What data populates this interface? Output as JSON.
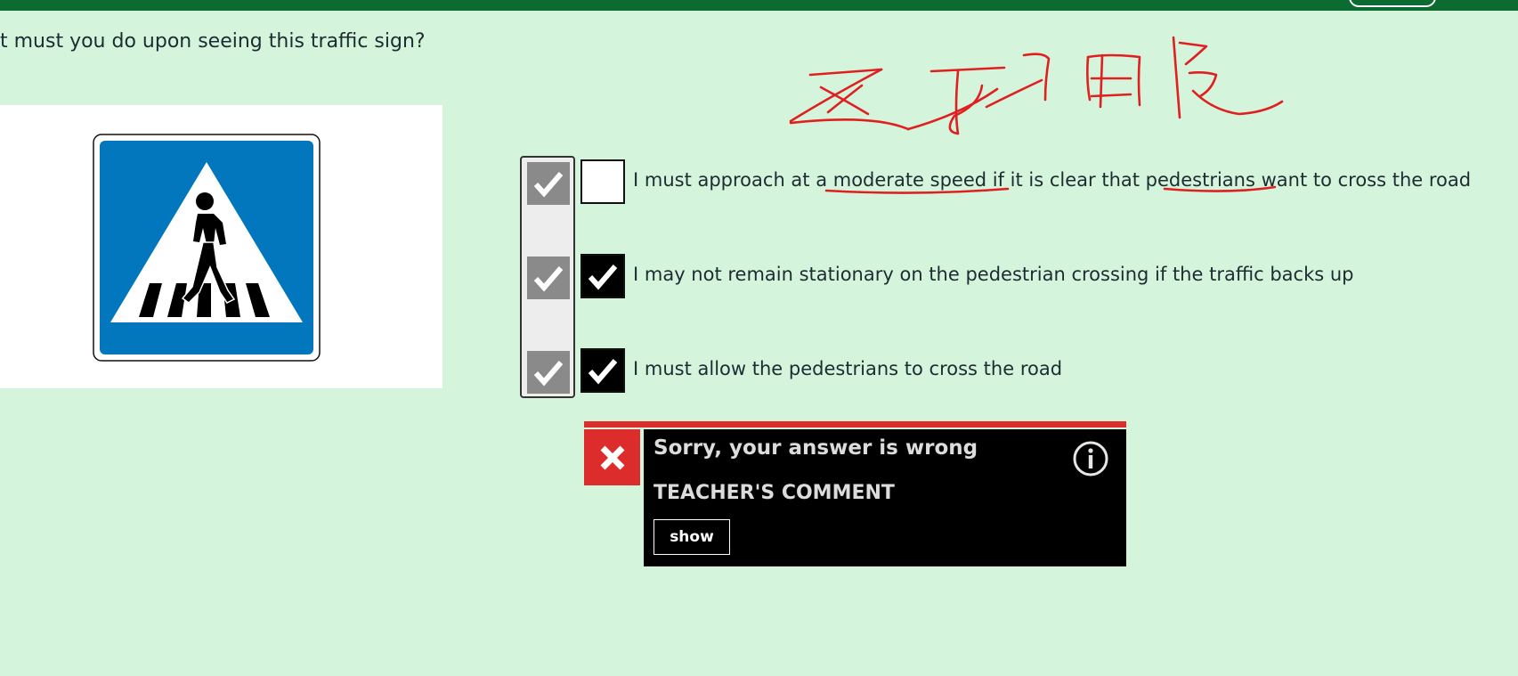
{
  "question": "t must you do upon seeing this traffic sign?",
  "sign": {
    "icon": "pedestrian-crossing-sign-icon",
    "colors": {
      "blue": "#0277bd",
      "white": "#ffffff",
      "black": "#000000"
    }
  },
  "annotation": {
    "type": "handwritten red ink overlay",
    "color": "#e02020"
  },
  "answers": [
    {
      "text": "I must approach at a moderate speed if it is clear that pedestrians want to cross the road",
      "user_checked": false,
      "correct_checked": true
    },
    {
      "text": "I may not remain stationary on the pedestrian crossing if the traffic backs up",
      "user_checked": true,
      "correct_checked": true
    },
    {
      "text": "I must allow the pedestrians to cross the road",
      "user_checked": true,
      "correct_checked": true
    }
  ],
  "feedback": {
    "title": "Sorry, your answer is wrong",
    "teacher_label": "TEACHER'S COMMENT",
    "show_label": "show",
    "error_icon": "close-icon",
    "info_icon": "info-icon",
    "colors": {
      "error": "#dc2c2c",
      "panel": "#000000"
    }
  },
  "theme": {
    "background": "#d4f5dc",
    "header": "#0b6b30"
  }
}
